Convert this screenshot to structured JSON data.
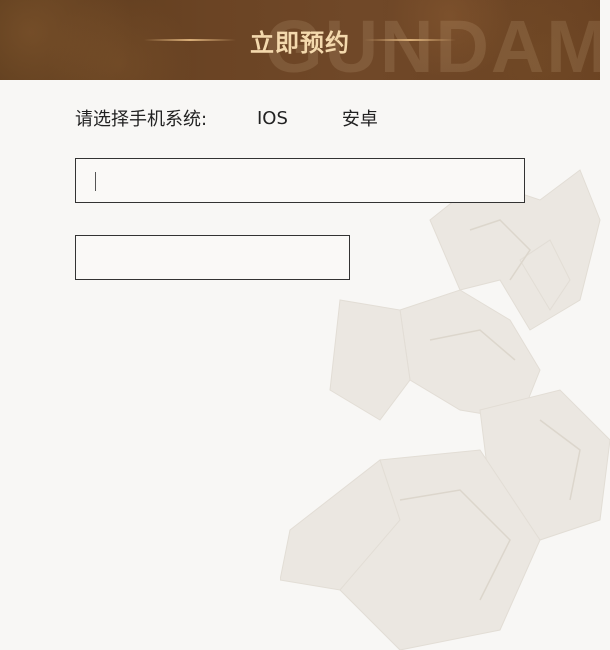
{
  "header": {
    "title": "立即预约",
    "watermark": "GUNDAM",
    "title_color": "#f4d9ad",
    "background_color": "#6b4424"
  },
  "form": {
    "os_prompt": "请选择手机系统:",
    "os_options": [
      "IOS",
      "安卓"
    ],
    "phone_input": {
      "value": "",
      "placeholder": ""
    },
    "code_input": {
      "value": "",
      "placeholder": ""
    }
  },
  "decor": {
    "background_art": "mecha-robot-watermark"
  }
}
